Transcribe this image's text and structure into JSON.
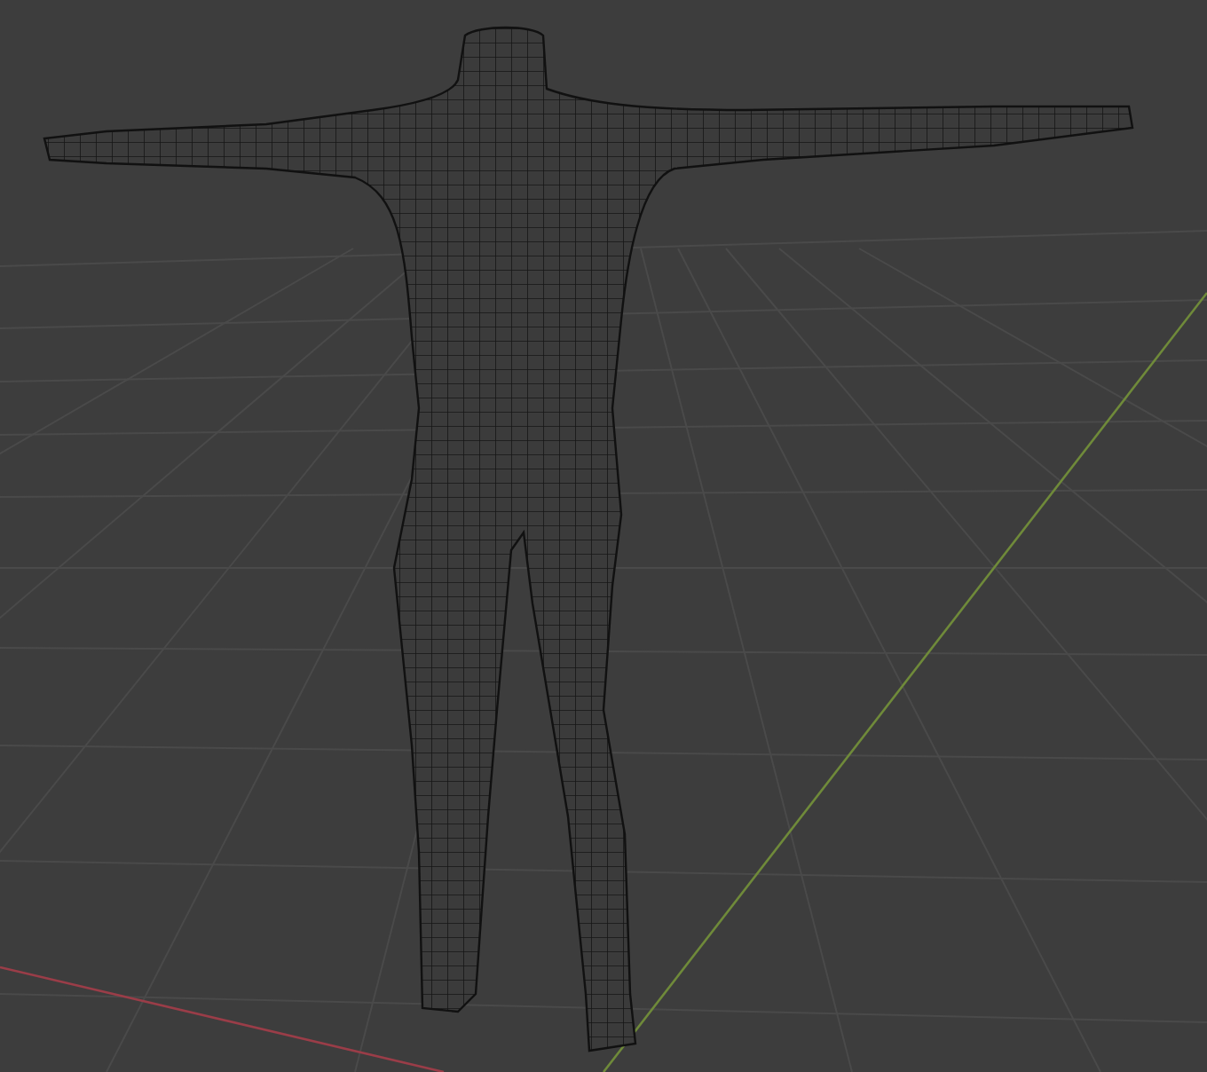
{
  "viewport": {
    "wireframe": true
  }
}
